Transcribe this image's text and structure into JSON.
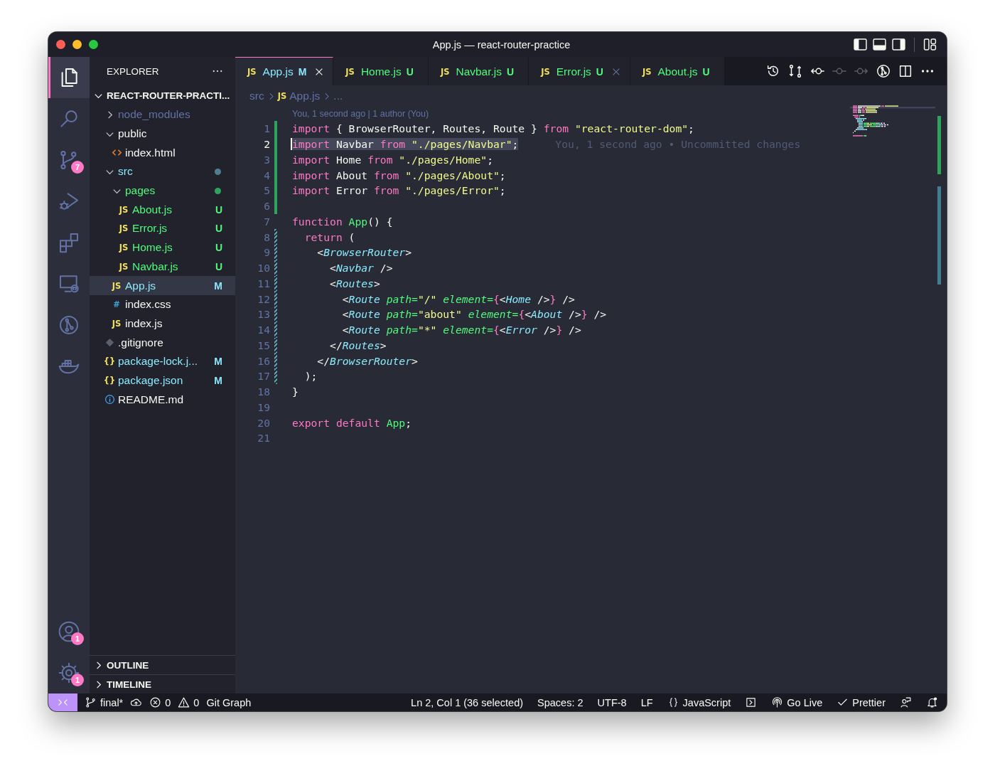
{
  "window": {
    "title": "App.js — react-router-practice"
  },
  "activity_bar": {
    "top": [
      {
        "kind": "files",
        "selected": true
      },
      {
        "kind": "search",
        "selected": false
      },
      {
        "kind": "source-control",
        "selected": false,
        "badge": "7"
      },
      {
        "kind": "run-debug",
        "selected": false
      },
      {
        "kind": "extensions",
        "selected": false
      },
      {
        "kind": "remote",
        "selected": false
      },
      {
        "kind": "git-graph",
        "selected": false
      },
      {
        "kind": "docker",
        "selected": false
      }
    ],
    "bottom": [
      {
        "kind": "account",
        "selected": false,
        "badge": "1"
      },
      {
        "kind": "settings",
        "selected": false,
        "badge": "1"
      }
    ]
  },
  "explorer": {
    "title": "EXPLORER",
    "section": "REACT-ROUTER-PRACTI...",
    "section_expanded": true,
    "tree": [
      {
        "name": "node_modules",
        "kind": "folder",
        "expanded": false,
        "color": "#6272a4",
        "selected": false
      },
      {
        "name": "public",
        "kind": "folder",
        "expanded": true,
        "color": "#f8f8f2",
        "selected": false,
        "children": [
          {
            "name": "index.html",
            "kind": "html",
            "color": "#f8f8f2",
            "selected": false
          }
        ]
      },
      {
        "name": "src",
        "kind": "folder",
        "expanded": true,
        "color": "#8be9fd",
        "dot": {
          "color": "#4f7f8c"
        },
        "selected": false,
        "children": [
          {
            "name": "pages",
            "kind": "folder",
            "expanded": true,
            "color": "#50fa7b",
            "dot": {
              "color": "#2ea35c"
            },
            "selected": false,
            "children": [
              {
                "name": "About.js",
                "kind": "js",
                "glyph": "JS",
                "color": "#50fa7b",
                "status": "U",
                "selected": false
              },
              {
                "name": "Error.js",
                "kind": "js",
                "glyph": "JS",
                "color": "#50fa7b",
                "status": "U",
                "selected": false
              },
              {
                "name": "Home.js",
                "kind": "js",
                "glyph": "JS",
                "color": "#50fa7b",
                "status": "U",
                "selected": false
              },
              {
                "name": "Navbar.js",
                "kind": "js",
                "glyph": "JS",
                "color": "#50fa7b",
                "status": "U",
                "selected": false
              }
            ]
          },
          {
            "name": "App.js",
            "kind": "js",
            "glyph": "JS",
            "color": "#8be9fd",
            "status": "M",
            "selected": true
          },
          {
            "name": "index.css",
            "kind": "css",
            "glyph": "#",
            "color": "#f8f8f2",
            "selected": false
          },
          {
            "name": "index.js",
            "kind": "js",
            "glyph": "JS",
            "color": "#f8f8f2",
            "selected": false
          }
        ]
      },
      {
        "name": ".gitignore",
        "kind": "git",
        "color": "#f8f8f2",
        "selected": false
      },
      {
        "name": "package-lock.j...",
        "kind": "json",
        "glyph": "{}",
        "color": "#8be9fd",
        "status": "M",
        "selected": false
      },
      {
        "name": "package.json",
        "kind": "json",
        "glyph": "{}",
        "color": "#8be9fd",
        "status": "M",
        "selected": false
      },
      {
        "name": "README.md",
        "kind": "info",
        "color": "#f8f8f2",
        "selected": false
      }
    ],
    "panels": [
      {
        "label": "OUTLINE",
        "expanded": false
      },
      {
        "label": "TIMELINE",
        "expanded": false
      }
    ]
  },
  "tabs": [
    {
      "label": "App.js",
      "glyph": "JS",
      "status": "M",
      "color": "#8be9fd",
      "selected": true,
      "close": true
    },
    {
      "label": "Home.js",
      "glyph": "JS",
      "status": "U",
      "color": "#50fa7b",
      "selected": false,
      "close": false
    },
    {
      "label": "Navbar.js",
      "glyph": "JS",
      "status": "U",
      "color": "#50fa7b",
      "selected": false,
      "close": false
    },
    {
      "label": "Error.js",
      "glyph": "JS",
      "status": "U",
      "color": "#50fa7b",
      "selected": false,
      "close": true
    },
    {
      "label": "About.js",
      "glyph": "JS",
      "status": "U",
      "color": "#50fa7b",
      "selected": false,
      "close": false
    }
  ],
  "toolbar": [
    {
      "kind": "history",
      "disabled": false
    },
    {
      "kind": "compare",
      "disabled": false
    },
    {
      "kind": "commit-left",
      "disabled": false
    },
    {
      "kind": "commit",
      "disabled": true
    },
    {
      "kind": "commit-right",
      "disabled": true
    },
    {
      "kind": "git-graph",
      "disabled": false
    },
    {
      "kind": "split",
      "disabled": false
    },
    {
      "kind": "more",
      "disabled": false
    }
  ],
  "breadcrumb": [
    {
      "text": "src"
    },
    {
      "glyph": "JS",
      "text": "App.js"
    },
    {
      "text": "..."
    }
  ],
  "codelens": "You, 1 second ago | 1 author (You)",
  "code": [
    {
      "n": "1",
      "kind": "added",
      "current": false,
      "selected": false,
      "tokens": [
        {
          "t": "import",
          "kind": "kw"
        },
        {
          "t": " { BrowserRouter, Routes, Route } ",
          "kind": "pl"
        },
        {
          "t": "from ",
          "kind": "kw"
        },
        {
          "t": "\"react-router-dom\"",
          "kind": "str"
        },
        {
          "t": ";",
          "kind": "pl"
        }
      ]
    },
    {
      "n": "2",
      "kind": "added",
      "current": true,
      "selected": true,
      "blame": "You, 1 second ago • Uncommitted changes",
      "tokens": [
        {
          "t": "import",
          "kind": "kw"
        },
        {
          "t": " Navbar ",
          "kind": "pl"
        },
        {
          "t": "from ",
          "kind": "kw"
        },
        {
          "t": "\"./pages/Navbar\"",
          "kind": "str"
        },
        {
          "t": ";",
          "kind": "pl"
        }
      ]
    },
    {
      "n": "3",
      "kind": "added",
      "current": false,
      "selected": false,
      "tokens": [
        {
          "t": "import",
          "kind": "kw"
        },
        {
          "t": " Home ",
          "kind": "pl"
        },
        {
          "t": "from ",
          "kind": "kw"
        },
        {
          "t": "\"./pages/Home\"",
          "kind": "str"
        },
        {
          "t": ";",
          "kind": "pl"
        }
      ]
    },
    {
      "n": "4",
      "kind": "added",
      "current": false,
      "selected": false,
      "tokens": [
        {
          "t": "import",
          "kind": "kw"
        },
        {
          "t": " About ",
          "kind": "pl"
        },
        {
          "t": "from ",
          "kind": "kw"
        },
        {
          "t": "\"./pages/About\"",
          "kind": "str"
        },
        {
          "t": ";",
          "kind": "pl"
        }
      ]
    },
    {
      "n": "5",
      "kind": "added",
      "current": false,
      "selected": false,
      "tokens": [
        {
          "t": "import",
          "kind": "kw"
        },
        {
          "t": " Error ",
          "kind": "pl"
        },
        {
          "t": "from ",
          "kind": "kw"
        },
        {
          "t": "\"./pages/Error\"",
          "kind": "str"
        },
        {
          "t": ";",
          "kind": "pl"
        }
      ]
    },
    {
      "n": "6",
      "kind": "added",
      "current": false,
      "selected": false
    },
    {
      "n": "7",
      "kind": "plain",
      "current": false,
      "selected": false,
      "tokens": [
        {
          "t": "function ",
          "kind": "kw"
        },
        {
          "t": "App",
          "kind": "fn"
        },
        {
          "t": "() {",
          "kind": "pl"
        }
      ]
    },
    {
      "n": "8",
      "kind": "modified",
      "current": false,
      "selected": false,
      "tokens": [
        {
          "t": "  return",
          "kind": "kw"
        },
        {
          "t": " (",
          "kind": "pl"
        }
      ]
    },
    {
      "n": "9",
      "kind": "modified",
      "current": false,
      "selected": false,
      "tokens": [
        {
          "t": "    <",
          "kind": "pl"
        },
        {
          "t": "BrowserRouter",
          "kind": "tag"
        },
        {
          "t": ">",
          "kind": "pl"
        }
      ]
    },
    {
      "n": "10",
      "kind": "modified",
      "current": false,
      "selected": false,
      "tokens": [
        {
          "t": "      <",
          "kind": "pl"
        },
        {
          "t": "Navbar",
          "kind": "tag"
        },
        {
          "t": " />",
          "kind": "pl"
        }
      ]
    },
    {
      "n": "11",
      "kind": "modified",
      "current": false,
      "selected": false,
      "tokens": [
        {
          "t": "      <",
          "kind": "pl"
        },
        {
          "t": "Routes",
          "kind": "tag"
        },
        {
          "t": ">",
          "kind": "pl"
        }
      ]
    },
    {
      "n": "12",
      "kind": "modified",
      "current": false,
      "selected": false,
      "tokens": [
        {
          "t": "        <",
          "kind": "pl"
        },
        {
          "t": "Route ",
          "kind": "tag"
        },
        {
          "t": "path=",
          "kind": "attr"
        },
        {
          "t": "\"/\" ",
          "kind": "str"
        },
        {
          "t": "element=",
          "kind": "attr"
        },
        {
          "t": "{",
          "kind": "br"
        },
        {
          "t": "<",
          "kind": "pl"
        },
        {
          "t": "Home",
          "kind": "tag"
        },
        {
          "t": " />",
          "kind": "pl"
        },
        {
          "t": "}",
          "kind": "br"
        },
        {
          "t": " />",
          "kind": "pl"
        }
      ]
    },
    {
      "n": "13",
      "kind": "modified",
      "current": false,
      "selected": false,
      "tokens": [
        {
          "t": "        <",
          "kind": "pl"
        },
        {
          "t": "Route ",
          "kind": "tag"
        },
        {
          "t": "path=",
          "kind": "attr"
        },
        {
          "t": "\"about\" ",
          "kind": "str"
        },
        {
          "t": "element=",
          "kind": "attr"
        },
        {
          "t": "{",
          "kind": "br"
        },
        {
          "t": "<",
          "kind": "pl"
        },
        {
          "t": "About",
          "kind": "tag"
        },
        {
          "t": " />",
          "kind": "pl"
        },
        {
          "t": "}",
          "kind": "br"
        },
        {
          "t": " />",
          "kind": "pl"
        }
      ]
    },
    {
      "n": "14",
      "kind": "modified",
      "current": false,
      "selected": false,
      "tokens": [
        {
          "t": "        <",
          "kind": "pl"
        },
        {
          "t": "Route ",
          "kind": "tag"
        },
        {
          "t": "path=",
          "kind": "attr"
        },
        {
          "t": "\"*\" ",
          "kind": "str"
        },
        {
          "t": "element=",
          "kind": "attr"
        },
        {
          "t": "{",
          "kind": "br"
        },
        {
          "t": "<",
          "kind": "pl"
        },
        {
          "t": "Error",
          "kind": "tag"
        },
        {
          "t": " />",
          "kind": "pl"
        },
        {
          "t": "}",
          "kind": "br"
        },
        {
          "t": " />",
          "kind": "pl"
        }
      ]
    },
    {
      "n": "15",
      "kind": "modified",
      "current": false,
      "selected": false,
      "tokens": [
        {
          "t": "      </",
          "kind": "pl"
        },
        {
          "t": "Routes",
          "kind": "tag"
        },
        {
          "t": ">",
          "kind": "pl"
        }
      ]
    },
    {
      "n": "16",
      "kind": "modified",
      "current": false,
      "selected": false,
      "tokens": [
        {
          "t": "    </",
          "kind": "pl"
        },
        {
          "t": "BrowserRouter",
          "kind": "tag"
        },
        {
          "t": ">",
          "kind": "pl"
        }
      ]
    },
    {
      "n": "17",
      "kind": "modified",
      "current": false,
      "selected": false,
      "tokens": [
        {
          "t": "  );",
          "kind": "pl"
        }
      ]
    },
    {
      "n": "18",
      "kind": "plain",
      "current": false,
      "selected": false,
      "tokens": [
        {
          "t": "}",
          "kind": "pl"
        }
      ]
    },
    {
      "n": "19",
      "kind": "plain",
      "current": false,
      "selected": false
    },
    {
      "n": "20",
      "kind": "plain",
      "current": false,
      "selected": false,
      "tokens": [
        {
          "t": "export default ",
          "kind": "kw"
        },
        {
          "t": "App",
          "kind": "fn"
        },
        {
          "t": ";",
          "kind": "pl"
        }
      ]
    },
    {
      "n": "21",
      "kind": "plain",
      "current": false,
      "selected": false
    }
  ],
  "status_bar": {
    "left": [
      {
        "kind": "remote"
      },
      {
        "kind": "branch",
        "text": "final*"
      },
      {
        "kind": "sync"
      },
      {
        "kind": "errors",
        "text": "0"
      },
      {
        "kind": "warnings",
        "text": "0"
      },
      {
        "kind": "plain",
        "text": "Git Graph"
      }
    ],
    "right": [
      {
        "kind": "plain",
        "text": "Ln 2, Col 1 (36 selected)"
      },
      {
        "kind": "plain",
        "text": "Spaces: 2"
      },
      {
        "kind": "plain",
        "text": "UTF-8"
      },
      {
        "kind": "plain",
        "text": "LF"
      },
      {
        "kind": "language",
        "text": "JavaScript"
      },
      {
        "kind": "terminal"
      },
      {
        "kind": "golive",
        "text": "Go Live"
      },
      {
        "kind": "prettier",
        "text": "Prettier"
      },
      {
        "kind": "feedback"
      },
      {
        "kind": "bell"
      }
    ]
  }
}
